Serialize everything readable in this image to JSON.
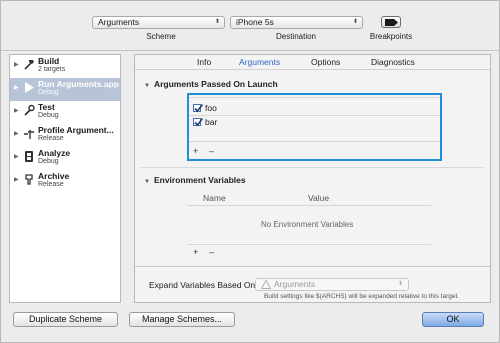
{
  "toolbar": {
    "scheme_value": "Arguments",
    "scheme_label": "Scheme",
    "destination_value": "iPhone 5s",
    "destination_label": "Destination",
    "breakpoints_label": "Breakpoints"
  },
  "sidebar": {
    "items": [
      {
        "title": "Build",
        "subtitle": "2 targets",
        "icon": "hammer-icon"
      },
      {
        "title": "Run Arguments.app",
        "subtitle": "Debug",
        "icon": "play-icon",
        "selected": true
      },
      {
        "title": "Test",
        "subtitle": "Debug",
        "icon": "wrench-icon"
      },
      {
        "title": "Profile Argument...",
        "subtitle": "Release",
        "icon": "instruments-icon"
      },
      {
        "title": "Analyze",
        "subtitle": "Debug",
        "icon": "analyze-icon"
      },
      {
        "title": "Archive",
        "subtitle": "Release",
        "icon": "archive-icon"
      }
    ]
  },
  "tabs": [
    {
      "label": "Info"
    },
    {
      "label": "Arguments",
      "active": true
    },
    {
      "label": "Options"
    },
    {
      "label": "Diagnostics"
    }
  ],
  "arguments_section": {
    "title": "Arguments Passed On Launch",
    "items": [
      {
        "label": "foo",
        "checked": true
      },
      {
        "label": "bar",
        "checked": true
      }
    ],
    "add_label": "+",
    "remove_label": "–"
  },
  "env_section": {
    "title": "Environment Variables",
    "col_name": "Name",
    "col_value": "Value",
    "empty_text": "No Environment Variables",
    "add_label": "+",
    "remove_label": "–"
  },
  "expand": {
    "label": "Expand Variables Based On",
    "value": "Arguments",
    "hint": "Build settings like $(ARCHS) will be expanded relative to this target."
  },
  "buttons": {
    "duplicate": "Duplicate Scheme",
    "manage": "Manage Schemes...",
    "ok": "OK"
  },
  "colors": {
    "accent": "#2f68c8",
    "selection": "#b7c3d6",
    "highlight_border": "#1e8fd6"
  }
}
